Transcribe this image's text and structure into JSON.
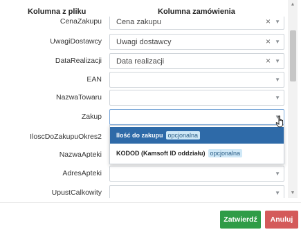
{
  "columns": {
    "source": "Kolumna z pliku",
    "target": "Kolumna zamówienia"
  },
  "rows": [
    {
      "source": "CenaZakupu",
      "value": "Cena zakupu",
      "clearable": true
    },
    {
      "source": "UwagiDostawcy",
      "value": "Uwagi dostawcy",
      "clearable": true
    },
    {
      "source": "DataRealizacji",
      "value": "Data realizacji",
      "clearable": true
    },
    {
      "source": "EAN",
      "value": "",
      "clearable": false
    },
    {
      "source": "NazwaTowaru",
      "value": "",
      "clearable": false
    },
    {
      "source": "Zakup",
      "value": "",
      "clearable": false,
      "open": true
    },
    {
      "source": "IloscDoZakupuOkres2",
      "value": "",
      "clearable": false
    },
    {
      "source": "NazwaApteki",
      "value": "",
      "clearable": false
    },
    {
      "source": "AdresApteki",
      "value": "",
      "clearable": false
    },
    {
      "source": "UpustCalkowity",
      "value": "",
      "clearable": false
    }
  ],
  "dropdown": {
    "options": [
      {
        "label": "Ilość do zakupu",
        "badge": "opcjonalna",
        "highlighted": true
      },
      {
        "label": "KODOD (Kamsoft ID oddziału)",
        "badge": "opcjonalna",
        "highlighted": false
      }
    ]
  },
  "icons": {
    "clear": "×",
    "caret": "▼",
    "scroll_up": "▲",
    "scroll_down": "▼"
  },
  "buttons": {
    "confirm": "Zatwierdź",
    "cancel": "Anuluj"
  },
  "colors": {
    "confirm": "#2f9c47",
    "cancel": "#d45a5a",
    "highlight": "#2e6aa8",
    "badge_bg": "#cfe8f7"
  }
}
